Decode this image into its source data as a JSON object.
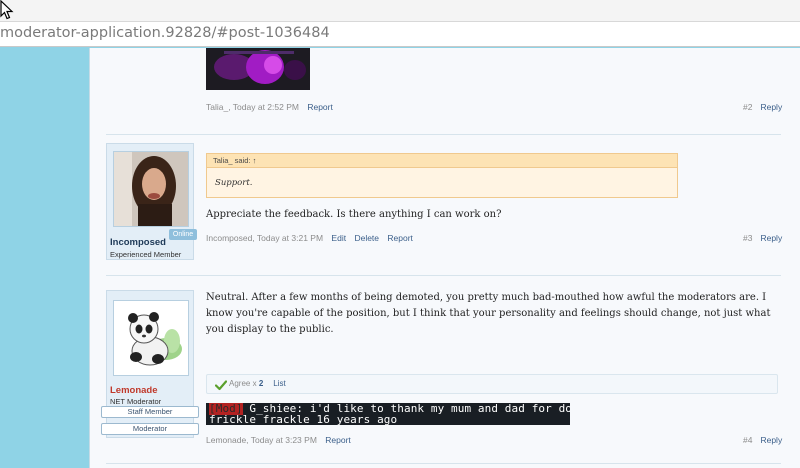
{
  "browser": {
    "url": "moderator-application.92828/#post-1036484"
  },
  "post2": {
    "author": "Talia_",
    "time": "Today at 2:52 PM",
    "actions": {
      "report": "Report"
    },
    "number": "#2",
    "reply": "Reply"
  },
  "post3": {
    "user": {
      "name": "Incomposed",
      "title": "Experienced Member",
      "status": "Online",
      "name_color": "#1f3a58"
    },
    "quote": {
      "author_said": "Talia_ said: ↑",
      "text": "Support."
    },
    "message": "Appreciate the feedback. Is there anything I can work on?",
    "author": "Incomposed",
    "time": "Today at 3:21 PM",
    "actions": {
      "edit": "Edit",
      "delete": "Delete",
      "report": "Report"
    },
    "number": "#3",
    "reply": "Reply"
  },
  "post4": {
    "user": {
      "name": "Lemonade",
      "title": "NET Moderator",
      "banner1": "Staff Member",
      "banner2": "Moderator",
      "name_color": "#c0392b"
    },
    "message": "Neutral. After a few months of being demoted, you pretty much bad-mouthed how awful the moderators are. I know you're capable of the position, but I think that your personality and feelings should change, not just what you display to the public.",
    "likes": {
      "label": "Agree x",
      "count": "2",
      "list": "List"
    },
    "signature": {
      "tag": "[Mod]",
      "line1": " G_shiee: i'd like to thank my mum and dad for doing the",
      "line2": "frickle frackle 16 years ago"
    },
    "author": "Lemonade",
    "time": "Today at 3:23 PM",
    "actions": {
      "report": "Report"
    },
    "number": "#4",
    "reply": "Reply"
  }
}
